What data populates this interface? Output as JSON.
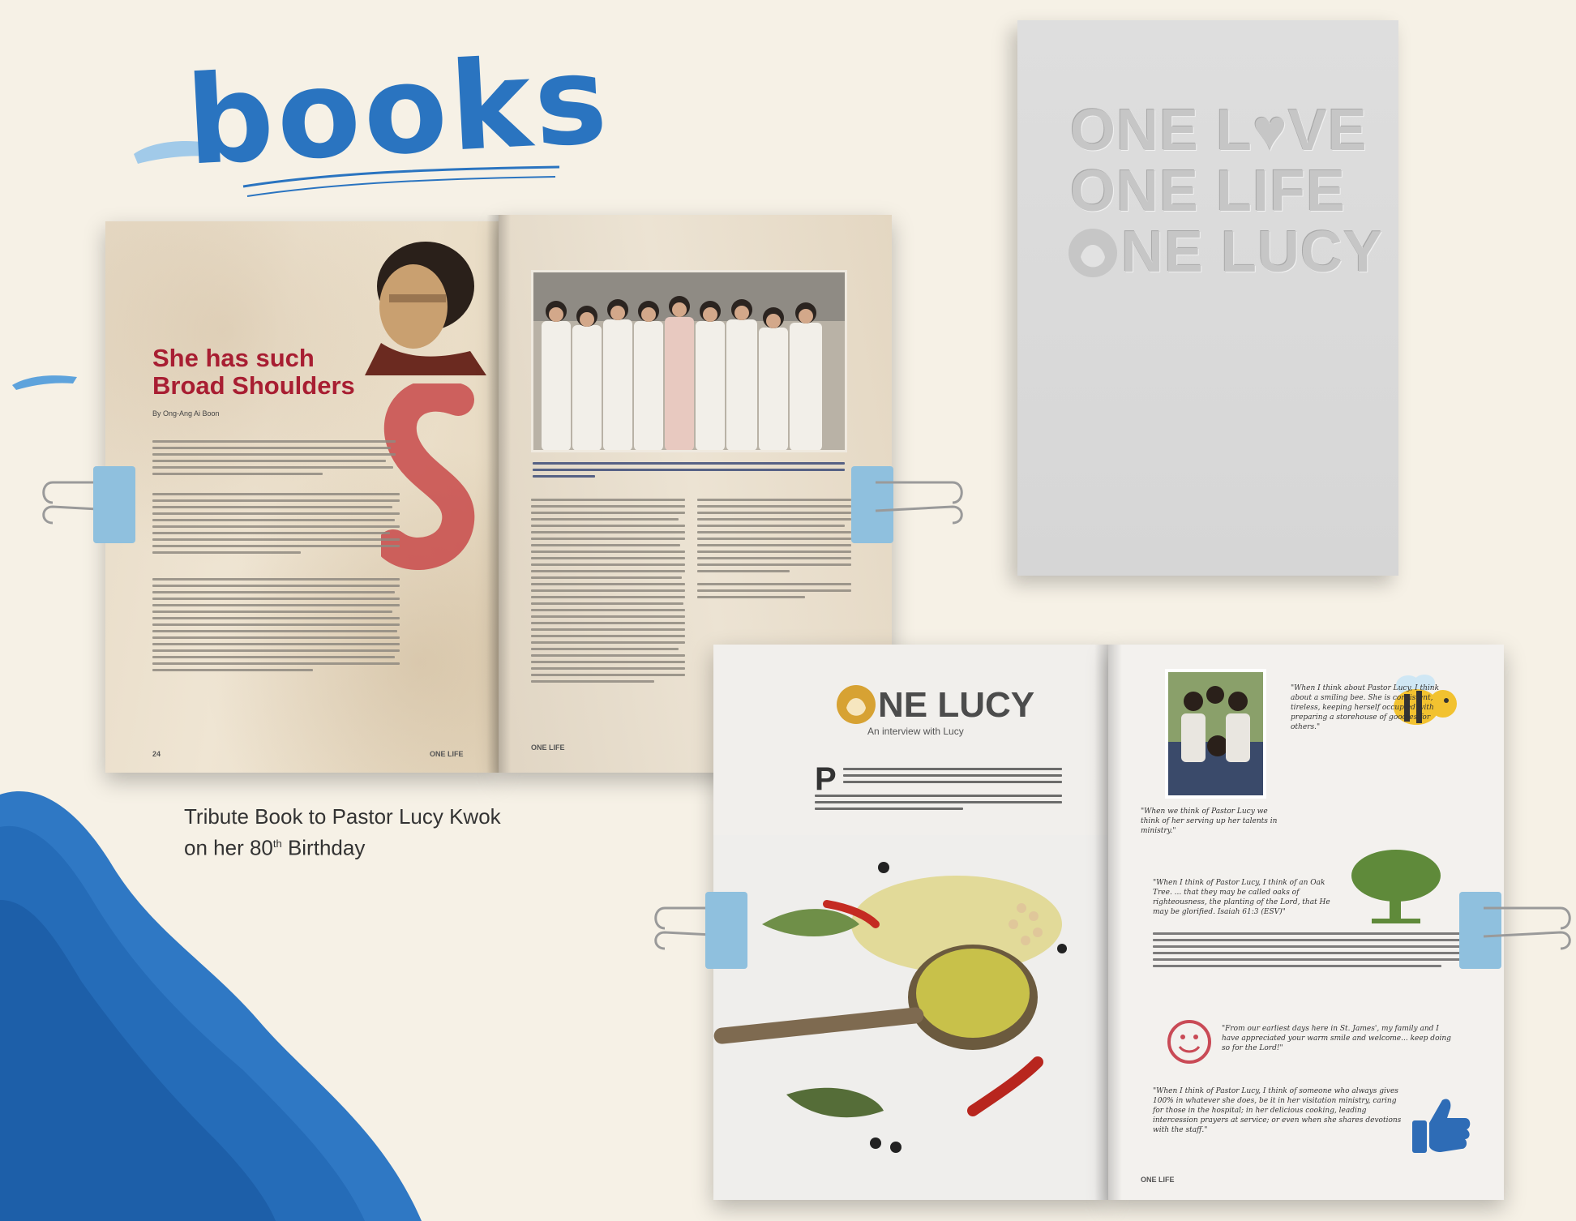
{
  "heading": "books",
  "book1": {
    "headline_line1": "She has such",
    "headline_line2": "Broad Shoulders",
    "byline": "By Ong-Ang Ai Boon",
    "footer_left_page": "24",
    "footer_left_title": "ONE LIFE",
    "footer_right_title": "ONE LIFE"
  },
  "cover": {
    "line1": "ONE L♥VE",
    "line2": "ONE LIFE",
    "line3": "NE LUCY"
  },
  "book2": {
    "title": "NE LUCY",
    "subtitle": "An interview with Lucy",
    "footer_title": "ONE LIFE",
    "quote_smile": "\"When I think about Pastor Lucy, I think about a smiling bee. She is consistent, tireless, keeping herself occupied with preparing a storehouse of goodies for others.\"",
    "quote_talents": "\"When we think of Pastor Lucy we think of her serving up her talents in ministry.\"",
    "quote_oak": "\"When I think of Pastor Lucy, I think of an Oak Tree. ... that they may be called oaks of righteousness, the planting of the Lord, that He may be glorified. Isaiah 61:3 (ESV)\"",
    "quote_welcome": "\"From our earliest days here in St. James', my family and I have appreciated your warm smile and welcome... keep doing so for the Lord!\"",
    "quote_gives": "\"When I think of Pastor Lucy, I think of someone who always gives 100% in whatever she does, be it in her visitation ministry, caring for those in the hospital; in her delicious cooking, leading intercession prayers at service; or even when she shares devotions with the staff.\""
  },
  "caption": {
    "line1": "Tribute Book to Pastor Lucy Kwok",
    "line2_prefix": "on her 80",
    "line2_sup": "th",
    "line2_suffix": " Birthday"
  }
}
